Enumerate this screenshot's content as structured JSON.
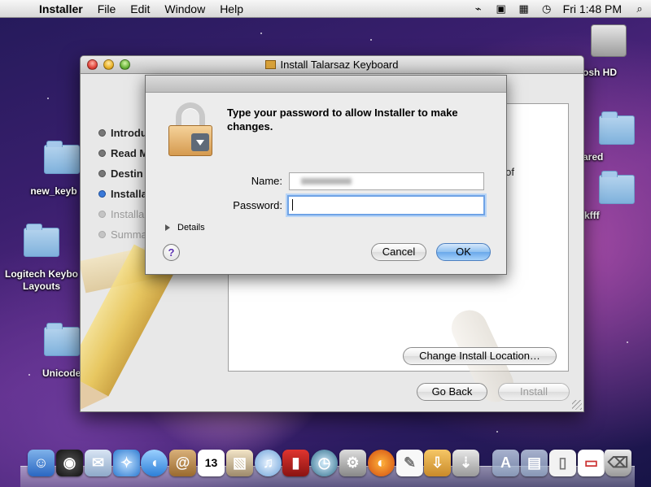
{
  "menubar": {
    "apple": "",
    "app_name": "Installer",
    "menus": [
      "File",
      "Edit",
      "Window",
      "Help"
    ],
    "clock": "Fri 1:48 PM",
    "status_icons": [
      "bluetooth-icon",
      "display-icon",
      "calendar-icon",
      "time-machine-icon"
    ],
    "spotlight": "search-icon"
  },
  "desktop": {
    "icons": [
      {
        "label": "osh HD",
        "icon": "hard-disk-icon"
      },
      {
        "label": "ared",
        "icon": "folder-icon"
      },
      {
        "label": "kfff",
        "icon": "folder-icon"
      },
      {
        "label": "new_keyb",
        "icon": "folder-icon"
      },
      {
        "label": "Logitech Keybo\nLayouts",
        "icon": "folder-icon"
      },
      {
        "label": "Unicode",
        "icon": "folder-icon"
      }
    ]
  },
  "installer": {
    "title": "Install Talarsaz Keyboard",
    "steps": [
      {
        "label": "Introdu",
        "state": "done"
      },
      {
        "label": "Read M",
        "state": "done"
      },
      {
        "label": "Destin",
        "state": "done"
      },
      {
        "label": "Installa",
        "state": "current"
      },
      {
        "label": "Installa",
        "state": "pending"
      },
      {
        "label": "Summa",
        "state": "pending"
      }
    ],
    "content_fragments": [
      ".",
      "of"
    ],
    "change_location_label": "Change Install Location…",
    "go_back_label": "Go Back",
    "install_label": "Install"
  },
  "auth_dialog": {
    "prompt": "Type your password to allow Installer to make changes.",
    "name_label": "Name:",
    "name_value": "",
    "password_label": "Password:",
    "password_value": "",
    "details_label": "Details",
    "help_label": "?",
    "cancel_label": "Cancel",
    "ok_label": "OK"
  },
  "dock": {
    "items": [
      "finder",
      "dashboard",
      "mail",
      "safari",
      "ichat",
      "address-book",
      "ical",
      "iphoto",
      "itunes",
      "photo-booth",
      "time-machine",
      "system-preferences",
      "firefox",
      "textedit",
      "installer",
      "downloads",
      "applications",
      "documents",
      "preview",
      "trash"
    ]
  }
}
